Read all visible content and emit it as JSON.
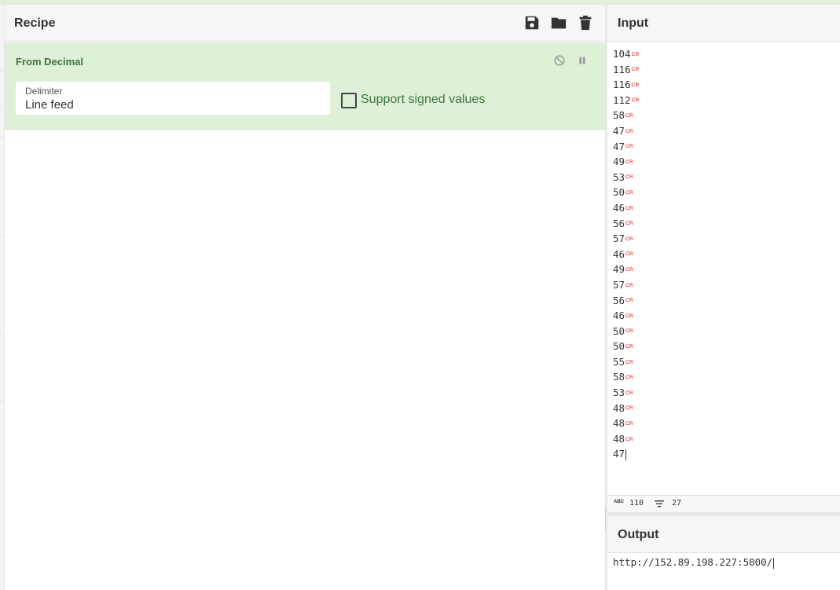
{
  "recipe": {
    "title": "Recipe",
    "icons": {
      "save": "save-icon",
      "load": "folder-icon",
      "clear": "trash-icon"
    },
    "operation": {
      "name": "From Decimal",
      "controls": {
        "disable": "disable-icon",
        "breakpoint": "pause-icon"
      },
      "delimiter": {
        "label": "Delimiter",
        "value": "Line feed"
      },
      "signed": {
        "label": "Support signed values",
        "checked": false
      }
    }
  },
  "input": {
    "title": "Input",
    "lines": [
      "104",
      "116",
      "116",
      "112",
      "58",
      "47",
      "47",
      "49",
      "53",
      "50",
      "46",
      "56",
      "57",
      "46",
      "49",
      "57",
      "56",
      "46",
      "50",
      "50",
      "55",
      "58",
      "53",
      "48",
      "48",
      "48",
      "47"
    ],
    "cr_marker": "CR",
    "status": {
      "length_icon": "ABC",
      "length": "110",
      "lines_icon": "lines-icon",
      "line_count": "27"
    }
  },
  "output": {
    "title": "Output",
    "value": "http://152.89.198.227:5000/"
  },
  "colors": {
    "op_bg": "#dff0d8",
    "op_text": "#3c763d",
    "cr": "#dd0000",
    "header_bg": "#f6f6f6"
  }
}
